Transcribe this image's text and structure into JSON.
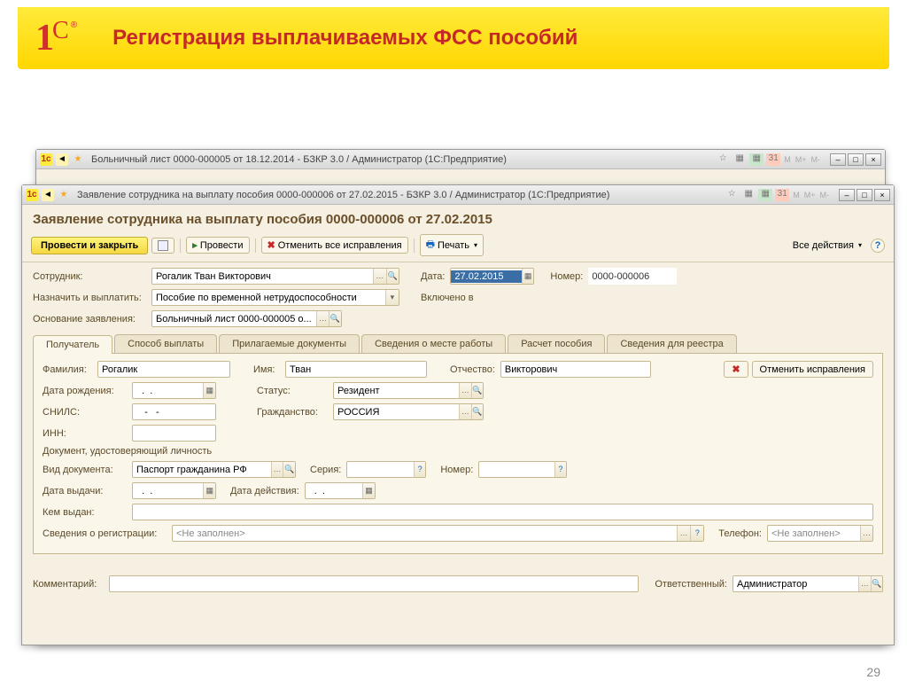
{
  "slide": {
    "title": "Регистрация выплачиваемых ФСС пособий",
    "page_number": "29"
  },
  "back_window": {
    "title": "Больничный лист 0000-000005 от 18.12.2014 - БЗКР 3.0 / Администратор   (1С:Предприятие)"
  },
  "front_window": {
    "title": "Заявление сотрудника на выплату пособия 0000-000006 от 27.02.2015 - БЗКР 3.0 / Администратор   (1С:Предприятие)",
    "doc_title": "Заявление сотрудника на выплату пособия 0000-000006 от 27.02.2015",
    "toolbar": {
      "commit_close": "Провести и закрыть",
      "commit": "Провести",
      "cancel_edits": "Отменить все исправления",
      "print": "Печать",
      "all_actions": "Все действия"
    },
    "fields": {
      "employee_label": "Сотрудник:",
      "employee_value": "Рогалик Тван Викторович",
      "date_label": "Дата:",
      "date_value": "27.02.2015",
      "number_label": "Номер:",
      "number_value": "0000-000006",
      "assign_label": "Назначить и выплатить:",
      "assign_value": "Пособие по временной нетрудоспособности",
      "included_label": "Включено в",
      "basis_label": "Основание заявления:",
      "basis_value": "Больничный лист 0000-000005 о..."
    },
    "tabs": {
      "t1": "Получатель",
      "t2": "Способ выплаты",
      "t3": "Прилагаемые документы",
      "t4": "Сведения о месте работы",
      "t5": "Расчет пособия",
      "t6": "Сведения для реестра"
    },
    "recipient": {
      "surname_label": "Фамилия:",
      "surname": "Рогалик",
      "name_label": "Имя:",
      "name": "Тван",
      "patronymic_label": "Отчество:",
      "patronymic": "Викторович",
      "cancel_edits_btn": "Отменить исправления",
      "dob_label": "Дата рождения:",
      "dob": "  .  .    ",
      "status_label": "Статус:",
      "status": "Резидент",
      "snils_label": "СНИЛС:",
      "snils": "   -   -",
      "citizenship_label": "Гражданство:",
      "citizenship": "РОССИЯ",
      "inn_label": "ИНН:",
      "inn": "",
      "doc_section": "Документ, удостоверяющий личность",
      "doc_type_label": "Вид документа:",
      "doc_type": "Паспорт гражданина РФ",
      "series_label": "Серия:",
      "series": "",
      "num_label": "Номер:",
      "num": "",
      "issue_date_label": "Дата выдачи:",
      "issue_date": "  .  .    ",
      "valid_date_label": "Дата действия:",
      "valid_date": "  .  .",
      "issued_by_label": "Кем выдан:",
      "issued_by": "",
      "reg_info_label": "Сведения о регистрации:",
      "reg_info": "<Не заполнен>",
      "phone_label": "Телефон:",
      "phone": "<Не заполнен>"
    },
    "footer": {
      "comment_label": "Комментарий:",
      "responsible_label": "Ответственный:",
      "responsible_value": "Администратор"
    }
  }
}
